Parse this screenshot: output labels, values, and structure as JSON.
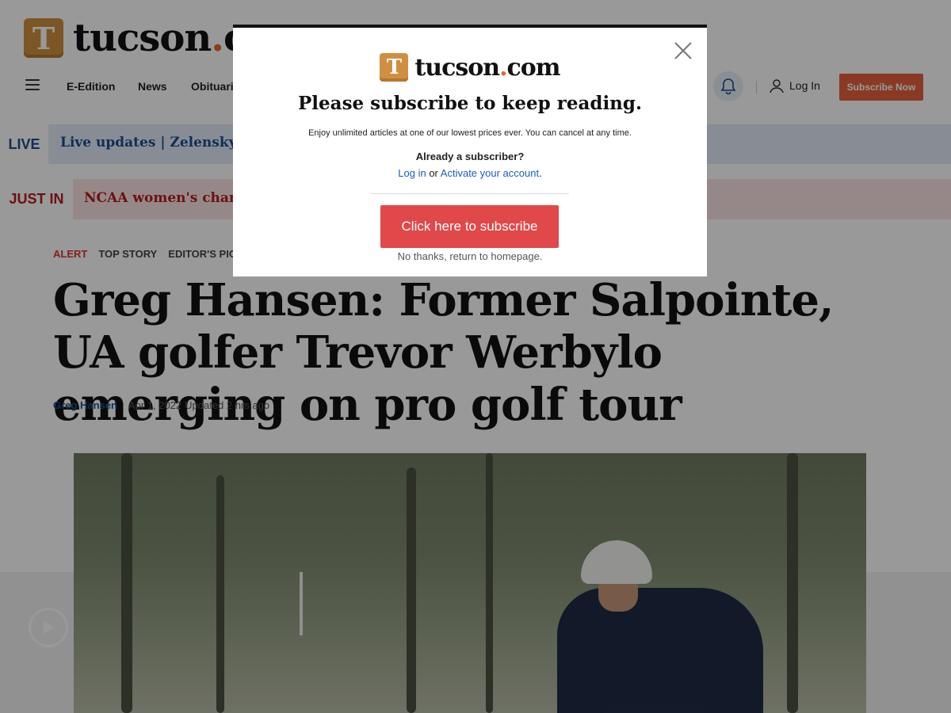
{
  "brand": {
    "logo_letter": "T",
    "name_main": "tucson",
    "name_dot": ".",
    "name_tld": "com",
    "accent_color": "#e5662b"
  },
  "nav": {
    "items": [
      "E-Edition",
      "News",
      "Obituaries"
    ],
    "login_label": "Log In",
    "subscribe_label": "Subscribe Now"
  },
  "live": {
    "label": "LIVE",
    "text": "Live updates | Zelenskyy warns of"
  },
  "just_in": {
    "label": "JUST IN",
    "text": "NCAA women's champio"
  },
  "tags": {
    "alert": "ALERT",
    "top_story": "TOP STORY",
    "editors_pick": "EDITOR'S PICK"
  },
  "article": {
    "headline": "Greg Hansen: Former Salpointe, UA golfer Trevor Werbylo emerging on pro golf tour",
    "author": "Greg Hansen",
    "date": "Apr 1, 2022",
    "updated": "Updated 2 hrs ago"
  },
  "modal": {
    "title": "Please subscribe to keep reading.",
    "description": "Enjoy unlimited articles at one of our lowest prices ever. You can cancel at any time.",
    "already": "Already a subscriber?",
    "login_link": "Log in",
    "or": "or",
    "activate_link": "Activate your account",
    "period": ".",
    "cta": "Click here to subscribe",
    "no_thanks": "No thanks, return to homepage."
  },
  "icons": {
    "menu": "hamburger-icon",
    "notifications": "bell-icon",
    "user": "user-icon",
    "close": "close-icon",
    "play": "play-icon"
  }
}
